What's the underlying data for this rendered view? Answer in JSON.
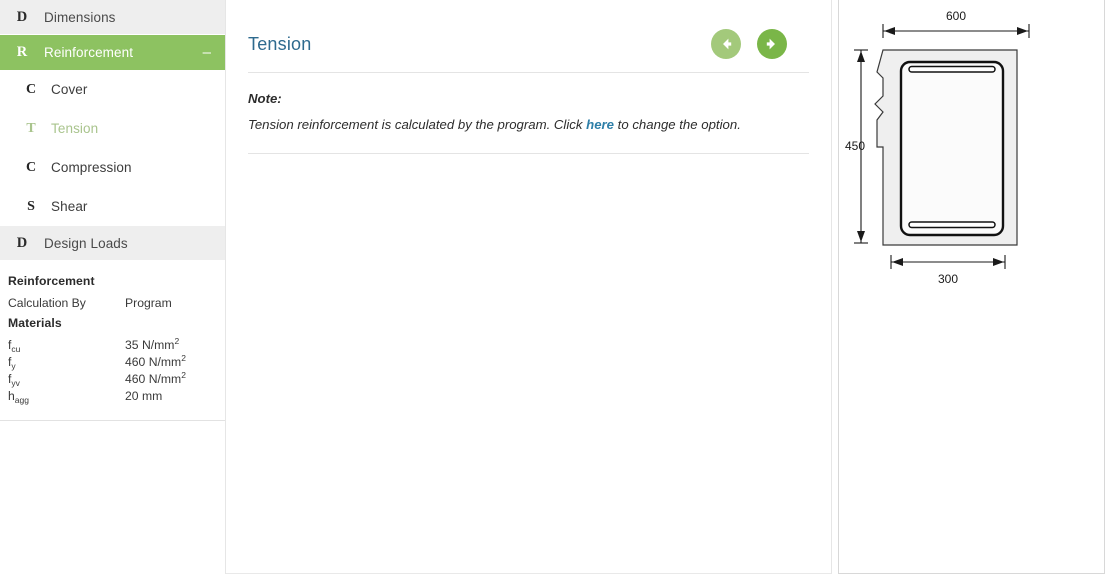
{
  "sidebar": {
    "nav": [
      {
        "icon_letter": "D",
        "icon_name": "dimensions-icon",
        "label": "Dimensions",
        "type": "group",
        "state": "normal"
      },
      {
        "icon_letter": "R",
        "icon_name": "reinforcement-icon",
        "label": "Reinforcement",
        "type": "group",
        "state": "active",
        "collapse_sign": "–"
      },
      {
        "icon_letter": "C",
        "icon_name": "cover-icon",
        "label": "Cover",
        "type": "sub",
        "state": "normal"
      },
      {
        "icon_letter": "T",
        "icon_name": "tension-icon",
        "label": "Tension",
        "type": "sub",
        "state": "current"
      },
      {
        "icon_letter": "C",
        "icon_name": "compression-icon",
        "label": "Compression",
        "type": "sub",
        "state": "normal"
      },
      {
        "icon_letter": "S",
        "icon_name": "shear-icon",
        "label": "Shear",
        "type": "sub",
        "state": "normal"
      },
      {
        "icon_letter": "D",
        "icon_name": "design-loads-icon",
        "label": "Design Loads",
        "type": "group",
        "state": "normal"
      }
    ],
    "summary": {
      "title": "Reinforcement",
      "calculation_by_label": "Calculation By",
      "calculation_by_value": "Program",
      "materials_title": "Materials",
      "materials": [
        {
          "symbol": "f",
          "subscript": "cu",
          "value": "35 N/mm",
          "superscript": "2"
        },
        {
          "symbol": "f",
          "subscript": "y",
          "value": "460 N/mm",
          "superscript": "2"
        },
        {
          "symbol": "f",
          "subscript": "yv",
          "value": "460 N/mm",
          "superscript": "2"
        },
        {
          "symbol": "h",
          "subscript": "agg",
          "value": "20 mm",
          "superscript": ""
        }
      ]
    }
  },
  "content": {
    "title": "Tension",
    "prev_button": {
      "name": "previous-page-button",
      "icon": "arrow-left-circle-icon"
    },
    "next_button": {
      "name": "next-page-button",
      "icon": "arrow-right-circle-icon"
    },
    "note_label": "Note:",
    "note_text_before": "Tension reinforcement is calculated by the program. Click ",
    "note_link": "here",
    "note_text_after": " to change the option."
  },
  "diagram": {
    "name": "beam-cross-section",
    "width_dimension": "600",
    "height_dimension": "450",
    "bottom_dimension": "300"
  },
  "colors": {
    "accent_green": "#8dc261",
    "next_arrow_green": "#7ab648",
    "prev_arrow_green": "#a3c97b",
    "title_blue": "#2e6a8e",
    "link_blue": "#2e7fa8",
    "group_bg": "#eeeeee",
    "current_item_green": "#a9c48d"
  }
}
